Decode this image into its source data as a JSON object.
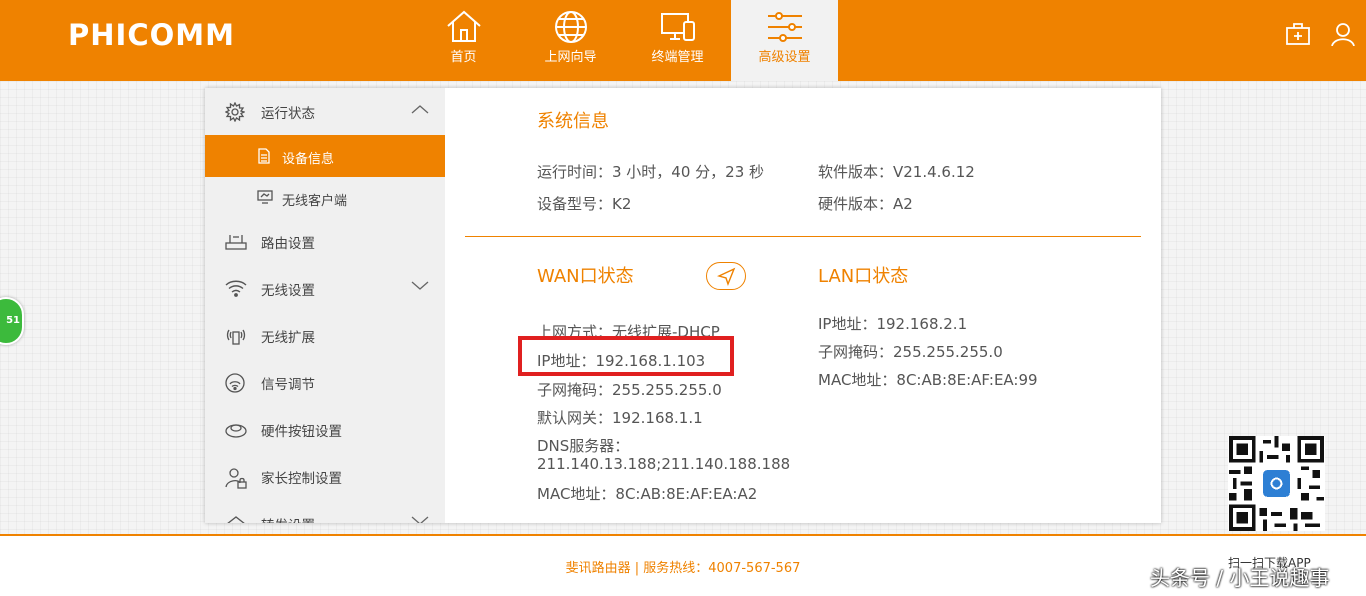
{
  "brand": {
    "logo": "PHICOMM",
    "accent": "#ef8200"
  },
  "nav": [
    {
      "label": "首页",
      "icon": "home-icon"
    },
    {
      "label": "上网向导",
      "icon": "globe-icon"
    },
    {
      "label": "终端管理",
      "icon": "devices-icon"
    },
    {
      "label": "高级设置",
      "icon": "sliders-icon",
      "active": true
    }
  ],
  "top_icons": [
    "toolbox-icon",
    "user-icon"
  ],
  "sidebar": {
    "items": [
      {
        "label": "运行状态",
        "icon": "gear-icon",
        "expanded": true
      },
      {
        "label": "设备信息",
        "icon": "document-icon",
        "active": true
      },
      {
        "label": "无线客户端",
        "icon": "monitor-icon"
      },
      {
        "label": "路由设置",
        "icon": "router-icon"
      },
      {
        "label": "无线设置",
        "icon": "wifi-icon"
      },
      {
        "label": "无线扩展",
        "icon": "signal-extend-icon"
      },
      {
        "label": "信号调节",
        "icon": "signal-icon"
      },
      {
        "label": "硬件按钮设置",
        "icon": "button-icon"
      },
      {
        "label": "家长控制设置",
        "icon": "parent-control-icon"
      },
      {
        "label": "转发设置",
        "icon": "forward-icon"
      }
    ]
  },
  "system_info": {
    "title": "系统信息",
    "uptime": "运行时间：3 小时，40 分，23 秒",
    "model": "设备型号：K2",
    "software": "软件版本：V21.4.6.12",
    "hardware": "硬件版本：A2"
  },
  "wan": {
    "title": "WAN口状态",
    "mode": "上网方式：无线扩展-DHCP",
    "ip": "IP地址：192.168.1.103",
    "mask": "子网掩码：255.255.255.0",
    "gateway": "默认网关：192.168.1.1",
    "dns_label": "DNS服务器：",
    "dns_value": "211.140.13.188;211.140.188.188",
    "mac": "MAC地址：8C:AB:8E:AF:EA:A2"
  },
  "lan": {
    "title": "LAN口状态",
    "ip": "IP地址：192.168.2.1",
    "mask": "子网掩码：255.255.255.0",
    "mac": "MAC地址：8C:AB:8E:AF:EA:99"
  },
  "footer": {
    "text": "斐讯路由器 | 服务热线：4007-567-567"
  },
  "qr": {
    "label": "扫一扫下载APP"
  },
  "watermark": "头条号 / 小王说趣事",
  "float_badge": "51"
}
